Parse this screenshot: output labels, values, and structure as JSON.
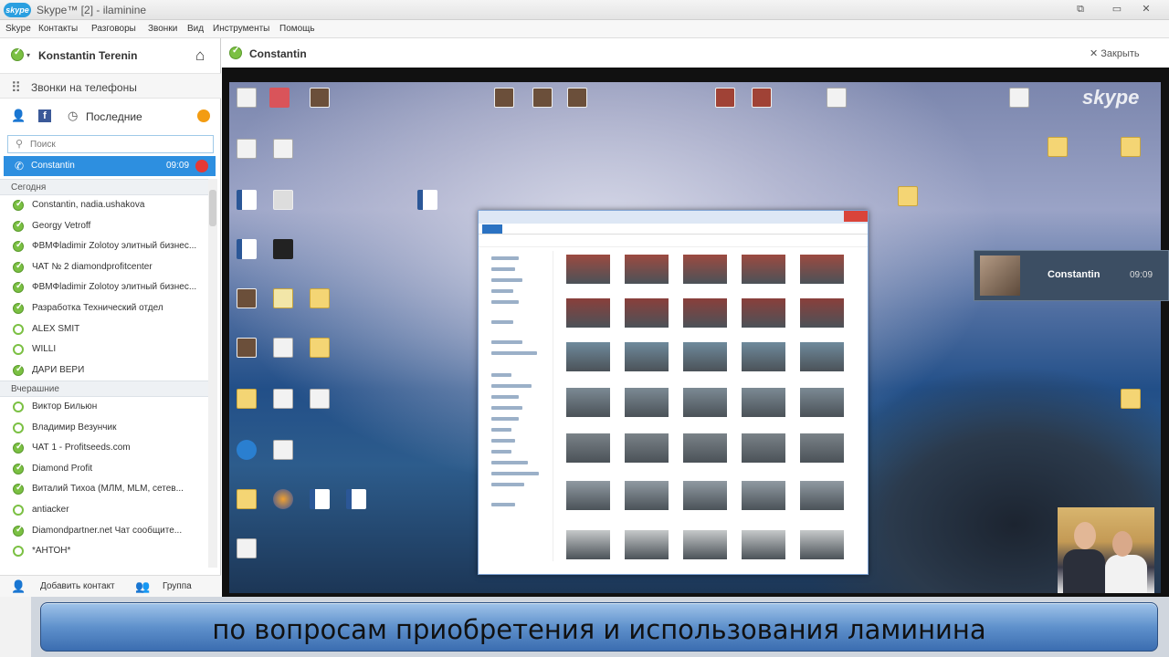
{
  "window": {
    "logo": "skype",
    "title": "Skype™ [2] - ilaminine",
    "controls": [
      "restore-icon",
      "minimize-icon",
      "close-icon"
    ]
  },
  "menu": [
    "Skype",
    "Контакты",
    "Разговоры",
    "Звонки",
    "Вид",
    "Инструменты",
    "Помощь"
  ],
  "user": {
    "name": "Konstantin Terenin"
  },
  "phone_calls_label": "Звонки на телефоны",
  "recent_tab_label": "Последние",
  "search": {
    "placeholder": "Поиск"
  },
  "active_call": {
    "name": "Constantin",
    "time": "09:09"
  },
  "sections": {
    "today": "Сегодня",
    "yesterday": "Вчерашние"
  },
  "today_contacts": [
    {
      "name": "Constantin, nadia.ushakova",
      "status": "online"
    },
    {
      "name": "Georgy Vetroff",
      "status": "online"
    },
    {
      "name": "ФВМФladimir Zolotoy элитный бизнес...",
      "status": "online"
    },
    {
      "name": "ЧАТ № 2 diamondprofitcenter",
      "status": "online"
    },
    {
      "name": "ФВМФladimir Zolotoy элитный бизнес...",
      "status": "online"
    },
    {
      "name": "Разработка Технический отдел",
      "status": "online"
    },
    {
      "name": "ALEX SMIT",
      "status": "offline"
    },
    {
      "name": "WILLI",
      "status": "offline"
    },
    {
      "name": "ДАРИ ВЕРИ",
      "status": "online"
    }
  ],
  "yesterday_contacts": [
    {
      "name": "Виктор Бильюн",
      "status": "offline"
    },
    {
      "name": "Владимир Везунчик",
      "status": "offline"
    },
    {
      "name": "ЧАТ 1 - Profitseeds.com",
      "status": "online"
    },
    {
      "name": "Diamond Profit",
      "status": "online"
    },
    {
      "name": "Виталий Тихоа (МЛМ, MLM, сетев...",
      "status": "online"
    },
    {
      "name": "antiacker",
      "status": "offline"
    },
    {
      "name": "Diamondpartner.net Чат сообщите...",
      "status": "online"
    },
    {
      "name": "*АНТОН*",
      "status": "offline"
    }
  ],
  "bottom": {
    "add_contact": "Добавить контакт",
    "group": "Группа"
  },
  "conversation": {
    "title": "Constantin",
    "close": "Закрыть"
  },
  "desktop_watermark": "skype",
  "call_overlay": {
    "name": "Constantin",
    "time": "09:09"
  },
  "caption": "по вопросам приобретения и использования ламинина",
  "colors": {
    "skype_blue": "#2d8fe0",
    "online_green": "#7bc043",
    "caption_blue": "#5f91cc"
  }
}
